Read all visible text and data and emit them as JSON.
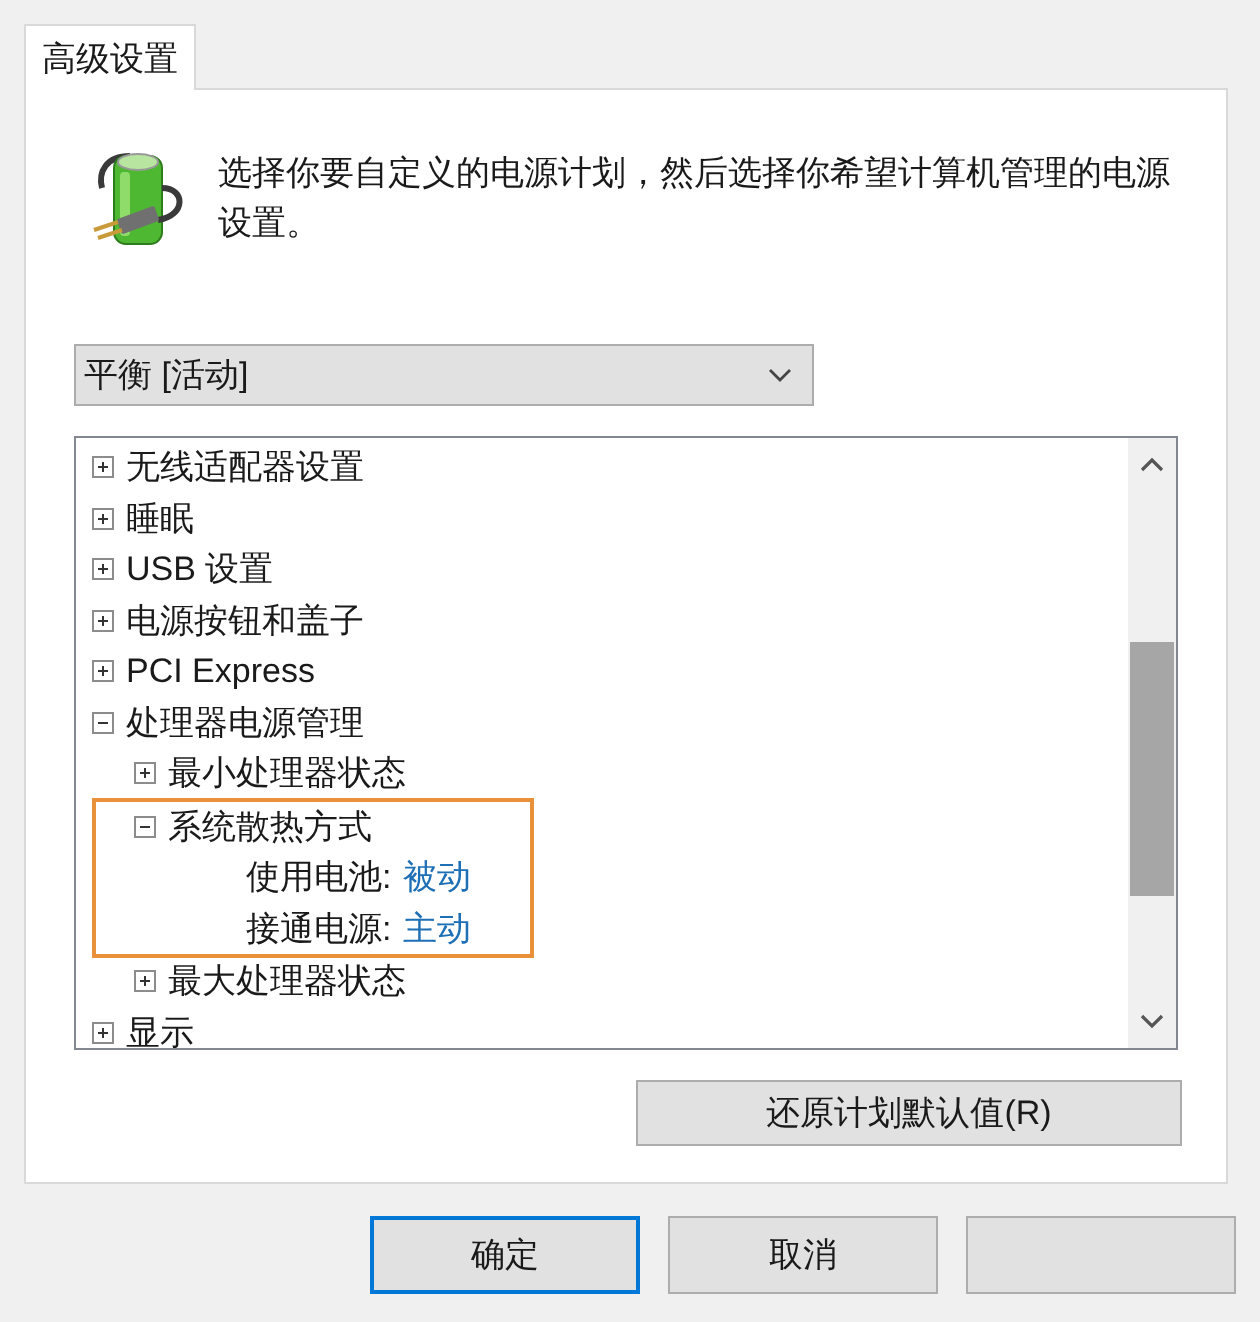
{
  "tabs": [
    {
      "label": "高级设置",
      "selected": true
    }
  ],
  "description": "选择你要自定义的电源计划，然后选择你希望计算机管理的电源设置。",
  "plan_select": {
    "value": "平衡 [活动]"
  },
  "tree": [
    {
      "kind": "group",
      "label": "无线适配器设置",
      "expanded": false
    },
    {
      "kind": "group",
      "label": "睡眠",
      "expanded": false
    },
    {
      "kind": "group",
      "label": "USB 设置",
      "expanded": false
    },
    {
      "kind": "group",
      "label": "电源按钮和盖子",
      "expanded": false
    },
    {
      "kind": "group",
      "label": "PCI Express",
      "expanded": false
    },
    {
      "kind": "group",
      "label": "处理器电源管理",
      "expanded": true,
      "children": [
        {
          "kind": "group",
          "label": "最小处理器状态",
          "expanded": false
        },
        {
          "kind": "group",
          "label": "系统散热方式",
          "expanded": true,
          "highlighted": true,
          "children": [
            {
              "kind": "setting",
              "label": "使用电池:",
              "value": "被动"
            },
            {
              "kind": "setting",
              "label": "接通电源:",
              "value": "主动"
            }
          ]
        },
        {
          "kind": "group",
          "label": "最大处理器状态",
          "expanded": false
        }
      ]
    },
    {
      "kind": "group",
      "label": "显示",
      "expanded": false
    }
  ],
  "restore_button": "还原计划默认值(R)",
  "buttons": [
    {
      "label": "确定",
      "default": true
    },
    {
      "label": "取消",
      "default": false
    },
    {
      "default": false
    }
  ]
}
